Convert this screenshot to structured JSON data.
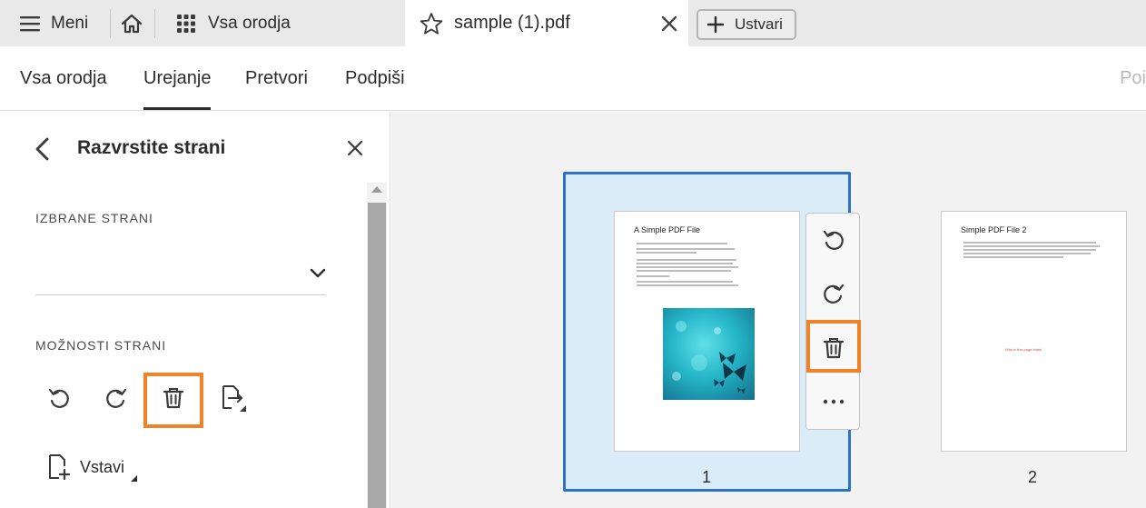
{
  "tabbar": {
    "menu_label": "Meni",
    "tools_label": "Vsa orodja",
    "active_tab_title": "sample (1).pdf",
    "create_label": "Ustvari"
  },
  "nav": {
    "items": [
      "Vsa orodja",
      "Urejanje",
      "Pretvori",
      "Podpiši"
    ],
    "active": "Urejanje",
    "search_placeholder": "Poi"
  },
  "panel": {
    "title": "Razvrstite strani",
    "selected_pages_label": "IZBRANE STRANI",
    "page_options_label": "MOŽNOSTI STRANI",
    "insert_label": "Vstavi"
  },
  "pages": [
    {
      "number": "1",
      "title": "A Simple PDF File",
      "selected": true
    },
    {
      "number": "2",
      "title": "Simple PDF File 2",
      "red_text": "Why is this page blank",
      "selected": false
    }
  ],
  "colors": {
    "highlight": "#f0832a",
    "selection_border": "#2a73c9",
    "selection_fill": "#dbecf9"
  },
  "icons": {
    "menu": "hamburger-icon",
    "home": "home-icon",
    "tools": "grid-icon",
    "favorite": "star-icon",
    "close": "close-icon",
    "create": "plus-icon",
    "rotate_left": "rotate-left-icon",
    "rotate_right": "rotate-right-icon",
    "delete": "trash-icon",
    "extract": "extract-page-icon",
    "insert": "insert-page-icon",
    "more": "more-icon"
  }
}
